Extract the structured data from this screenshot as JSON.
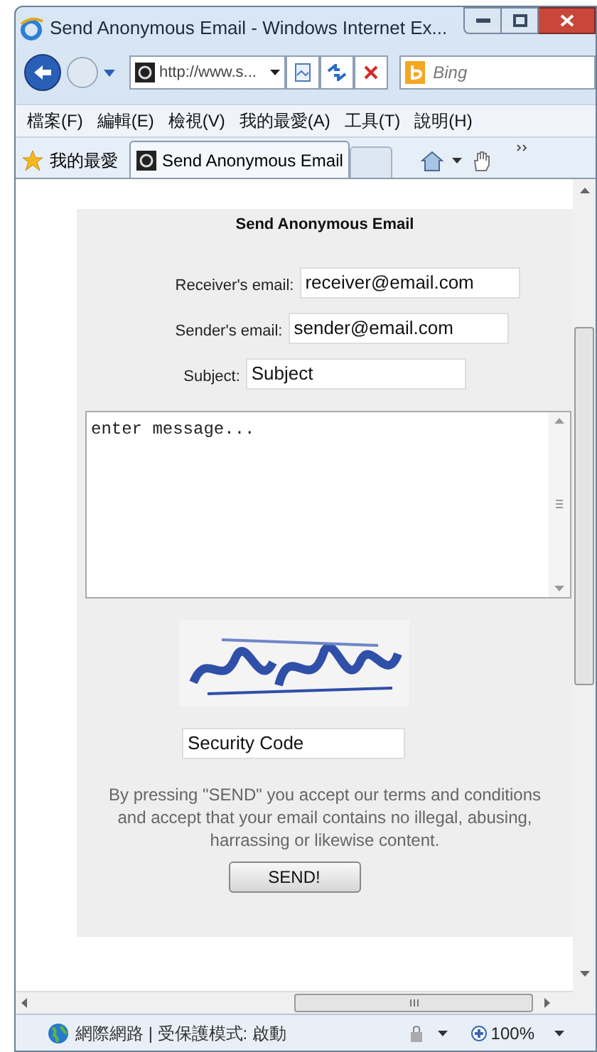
{
  "window": {
    "title": "Send Anonymous Email - Windows Internet Ex..."
  },
  "address_bar": {
    "value": "http://www.s..."
  },
  "search": {
    "placeholder": "Bing"
  },
  "menu": [
    "檔案(F)",
    "編輯(E)",
    "檢視(V)",
    "我的最愛(A)",
    "工具(T)",
    "說明(H)"
  ],
  "favorites": {
    "label": "我的最愛"
  },
  "tabs": [
    {
      "label": "Send Anonymous Email",
      "selected": true
    },
    {
      "selected": false
    }
  ],
  "form": {
    "heading": "Send Anonymous Email",
    "fields": [
      {
        "label": "Receiver's email:",
        "value": "receiver@email.com"
      },
      {
        "label": "Sender's email:",
        "value": "sender@email.com"
      },
      {
        "label": "Subject:",
        "value": "Subject"
      }
    ],
    "message": "enter message...",
    "security_code": "Security Code",
    "notice": "By pressing \"SEND\" you accept our terms and conditions and accept that your email contains no illegal, abusing, harrassing or likewise content.",
    "send_button": "SEND!"
  },
  "status_bar": {
    "zone": "網際網路 | 受保護模式: 啟動",
    "zoom": "100%"
  }
}
